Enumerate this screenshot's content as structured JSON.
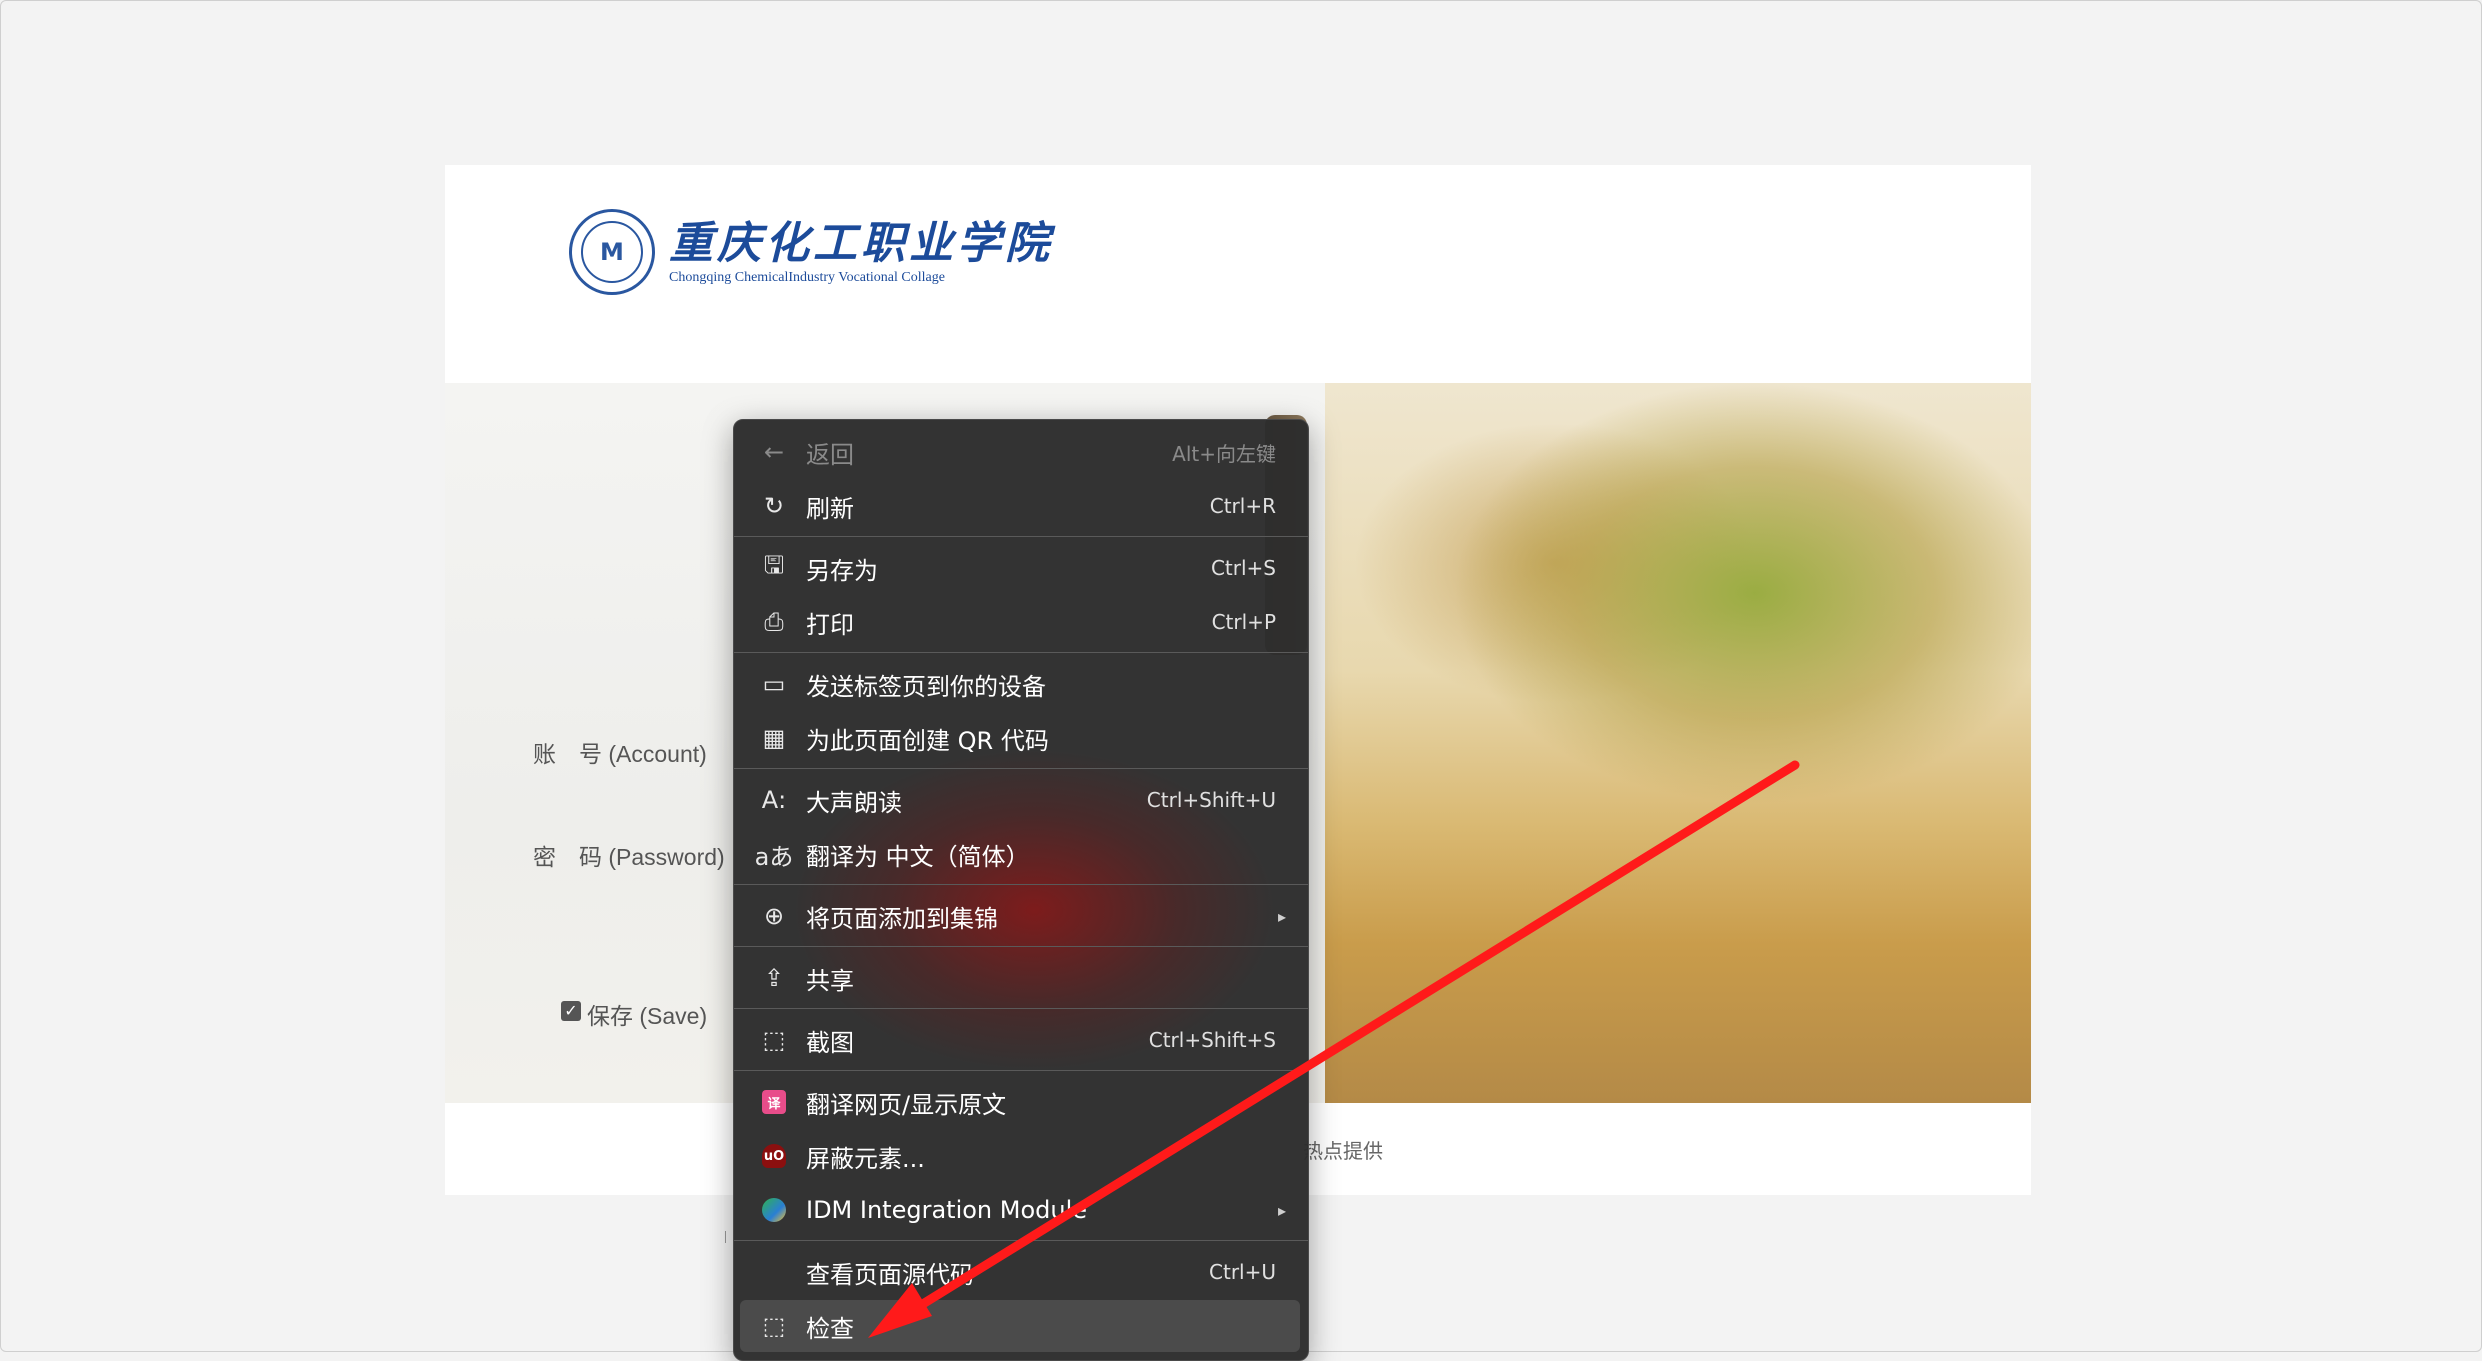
{
  "logo": {
    "cn": "重庆化工职业学院",
    "en": "Chongqing ChemicalIndustry Vocational Collage",
    "seal": "M"
  },
  "login": {
    "account_label": "账　号 (Account)",
    "password_label": "密　码 (Password)",
    "save_label": "保存 (Save)",
    "save_checked": true
  },
  "footer": {
    "text": "热点提供"
  },
  "context_menu": {
    "items": [
      {
        "icon": "back-arrow-icon",
        "label": "返回",
        "shortcut": "Alt+向左键",
        "disabled": true
      },
      {
        "icon": "refresh-icon",
        "label": "刷新",
        "shortcut": "Ctrl+R"
      },
      {
        "icon": "save-as-icon",
        "label": "另存为",
        "shortcut": "Ctrl+S"
      },
      {
        "icon": "print-icon",
        "label": "打印",
        "shortcut": "Ctrl+P"
      },
      {
        "icon": "send-to-device-icon",
        "label": "发送标签页到你的设备",
        "shortcut": ""
      },
      {
        "icon": "qr-code-icon",
        "label": "为此页面创建 QR 代码",
        "shortcut": ""
      },
      {
        "icon": "read-aloud-icon",
        "label": "大声朗读",
        "shortcut": "Ctrl+Shift+U"
      },
      {
        "icon": "translate-icon",
        "label": "翻译为 中文（简体）",
        "shortcut": ""
      },
      {
        "icon": "collections-icon",
        "label": "将页面添加到集锦",
        "shortcut": ""
      },
      {
        "icon": "share-icon",
        "label": "共享",
        "shortcut": ""
      },
      {
        "icon": "screenshot-icon",
        "label": "截图",
        "shortcut": "Ctrl+Shift+S"
      },
      {
        "icon": "translate-page-icon",
        "label": "翻译网页/显示原文",
        "shortcut": ""
      },
      {
        "icon": "ublock-icon",
        "label": "屏蔽元素...",
        "shortcut": ""
      },
      {
        "icon": "idm-icon",
        "label": "IDM Integration Module",
        "shortcut": ""
      },
      {
        "icon": "",
        "label": "查看页面源代码",
        "shortcut": "Ctrl+U"
      },
      {
        "icon": "inspect-icon",
        "label": "检查",
        "shortcut": ""
      }
    ]
  },
  "annotation": {
    "arrow_color": "#ff1a1a"
  }
}
